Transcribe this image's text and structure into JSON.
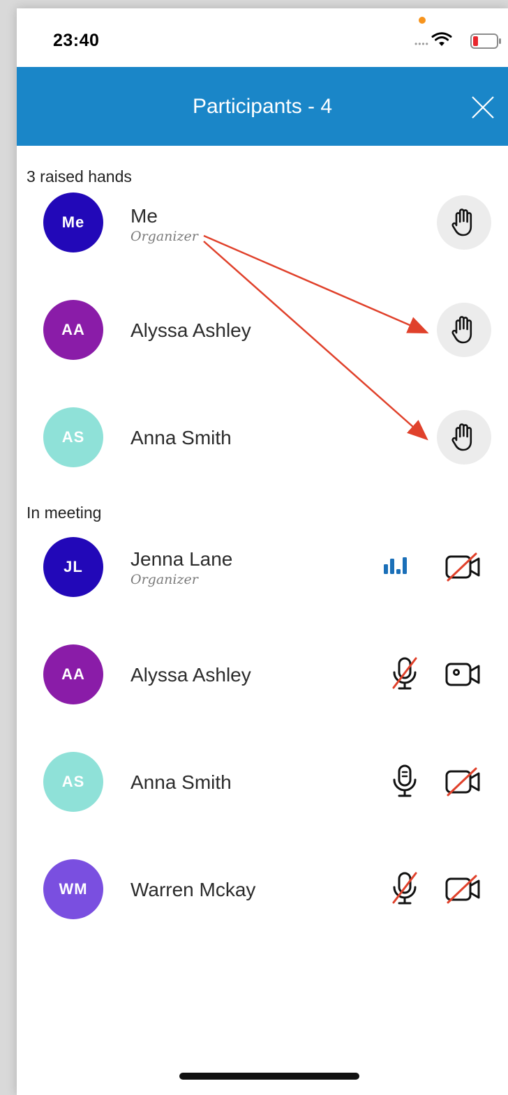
{
  "status_bar": {
    "time": "23:40"
  },
  "header": {
    "title": "Participants - 4"
  },
  "raised_hands": {
    "label": "3 raised hands",
    "participants": [
      {
        "initials": "Me",
        "name": "Me",
        "role": "Organizer",
        "avatar_color": "#2208b8"
      },
      {
        "initials": "AA",
        "name": "Alyssa Ashley",
        "role": "",
        "avatar_color": "#8a1ca8"
      },
      {
        "initials": "AS",
        "name": "Anna Smith",
        "role": "",
        "avatar_color": "#8fe1d8"
      }
    ]
  },
  "in_meeting": {
    "label": "In meeting",
    "participants": [
      {
        "initials": "JL",
        "name": "Jenna Lane",
        "role": "Organizer",
        "avatar_color": "#2208b8",
        "audio": "speaking-icon",
        "video": "camera-off-icon"
      },
      {
        "initials": "AA",
        "name": "Alyssa Ashley",
        "role": "",
        "avatar_color": "#8a1ca8",
        "audio": "mic-off-icon",
        "video": "camera-icon"
      },
      {
        "initials": "AS",
        "name": "Anna Smith",
        "role": "",
        "avatar_color": "#8fe1d8",
        "audio": "mic-icon",
        "video": "camera-off-icon"
      },
      {
        "initials": "WM",
        "name": "Warren Mckay",
        "role": "",
        "avatar_color": "#7a4fe0",
        "audio": "mic-off-icon",
        "video": "camera-off-icon"
      }
    ]
  },
  "colors": {
    "header": "#1a86c8",
    "annotation_arrow": "#e0412b",
    "speaking": "#1a6fb8",
    "muted_slash": "#e0412b"
  }
}
